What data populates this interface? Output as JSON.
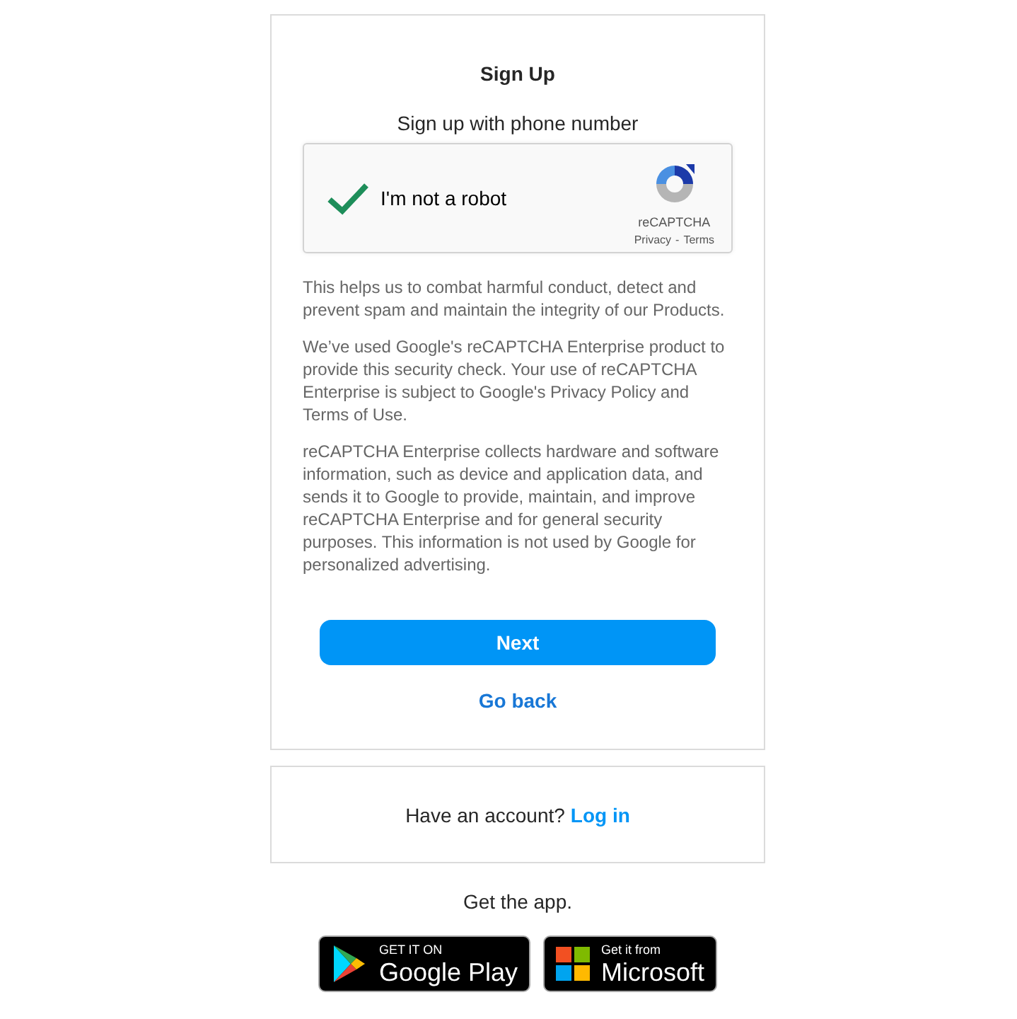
{
  "signup_card": {
    "title": "Sign Up",
    "subtitle": "Sign up with phone number",
    "recaptcha": {
      "label": "I'm not a robot",
      "checked": true,
      "brand": "reCAPTCHA",
      "privacy": "Privacy",
      "separator": "-",
      "terms": "Terms"
    },
    "paragraphs": [
      "This helps us to combat harmful conduct, detect and prevent spam and maintain the integrity of our Products.",
      "We’ve used Google's reCAPTCHA Enterprise product to provide this security check. Your use of reCAPTCHA Enterprise is subject to Google's Privacy Policy and Terms of Use.",
      "reCAPTCHA Enterprise collects hardware and software information, such as device and application data, and sends it to Google to provide, maintain, and improve reCAPTCHA Enterprise and for general security purposes. This information is not used by Google for personalized advertising."
    ],
    "next_button": "Next",
    "back_link": "Go back"
  },
  "login_card": {
    "text": "Have an account?",
    "link": "Log in"
  },
  "get_app": {
    "text": "Get the app.",
    "badges": [
      {
        "kind": "google",
        "small": "GET IT ON",
        "big": "Google Play"
      },
      {
        "kind": "microsoft",
        "small": "Get it from",
        "big": "Microsoft"
      }
    ]
  }
}
